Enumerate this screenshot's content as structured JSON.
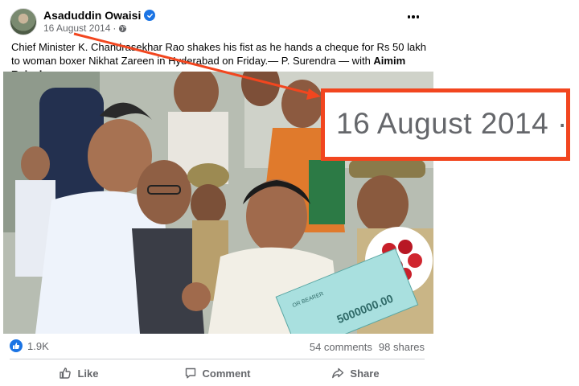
{
  "post": {
    "author": "Asaduddin Owaisi",
    "date": "16 August 2014",
    "separator": "·",
    "caption_main": "Chief Minister K. Chandrasekhar Rao shakes his fist as he hands a cheque for Rs 50 lakh to woman boxer Nikhat Zareen in Hyderabad on Friday.— P. Surendra — with ",
    "caption_tag": "Aimim Rajeshwar",
    "caption_end": "."
  },
  "photo": {
    "cheque_text": "5000000.00",
    "cheque_label": "OR BEARER"
  },
  "stats": {
    "reactions": "1.9K",
    "comments": "54 comments",
    "shares": "98 shares"
  },
  "actions": {
    "like": "Like",
    "comment": "Comment",
    "share": "Share"
  },
  "annotation": {
    "zoomed_date": "16 August 2014 ·",
    "highlight_color": "#f2461f"
  },
  "icons": [
    "verified-badge-icon",
    "globe-icon",
    "more-options-icon",
    "like-reaction-icon",
    "like-icon",
    "comment-icon",
    "share-icon"
  ]
}
